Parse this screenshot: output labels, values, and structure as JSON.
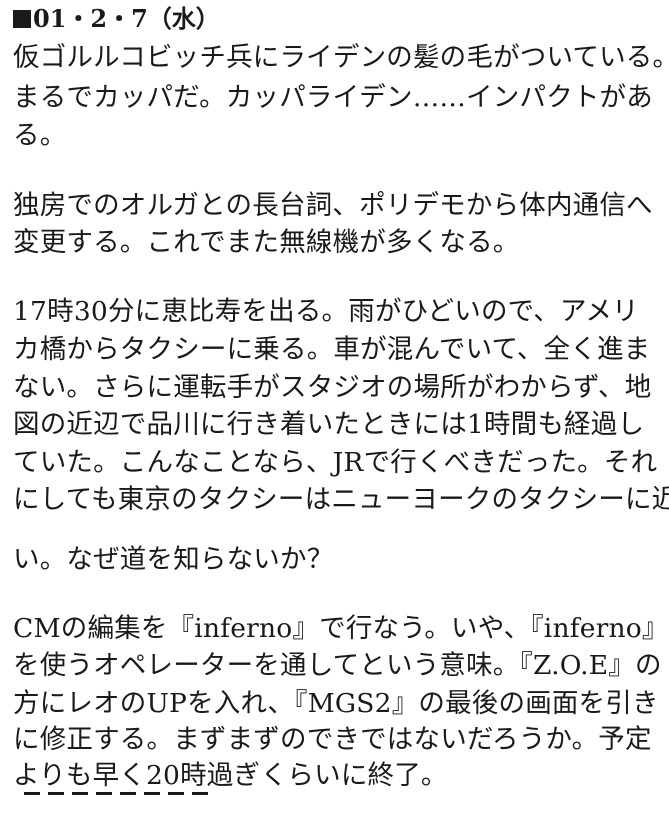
{
  "entry": {
    "date_label": "01・2・7（水）",
    "paragraphs": [
      {
        "lines": [
          "仮ゴルルコビッチ兵にライデンの髪の毛がついている。",
          "まるでカッパだ。カッパライデン……インパクトがあ",
          "る。"
        ]
      },
      {
        "lines": [
          "独房でのオルガとの長台詞、ポリデモから体内通信へ",
          "変更する。これでまた無線機が多くなる。"
        ]
      },
      {
        "lines": [
          "17時30分に恵比寿を出る。雨がひどいので、アメリ",
          "カ橋からタクシーに乗る。車が混んでいて、全く進ま",
          "ない。さらに運転手がスタジオの場所がわからず、地",
          "図の近辺で品川に行き着いたときには1時間も経過し",
          "ていた。こんなことなら、JRで行くべきだった。それ",
          "にしても東京のタクシーはニューヨークのタクシーに近"
        ]
      },
      {
        "lines": [
          "い。なぜ道を知らないか？"
        ]
      },
      {
        "lines": [
          "CMの編集を『inferno』で行なう。いや、『inferno』",
          "を使うオペレーターを通してという意味。『Z.O.E』の",
          "方にレオのUPを入れ、『MGS2』の最後の画面を引き",
          "に修正する。まずまずのできではないだろうか。予定",
          "よりも早く20時過ぎくらいに終了。"
        ]
      }
    ],
    "end_marker_count": 8
  }
}
